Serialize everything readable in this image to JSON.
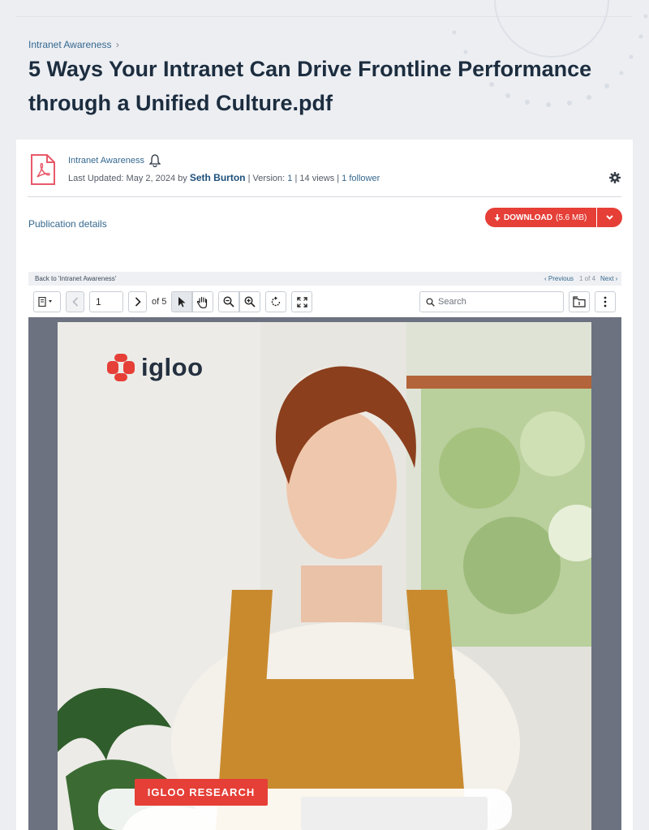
{
  "breadcrumb": {
    "label": "Intranet Awareness",
    "separator": "›"
  },
  "page_title": "5 Ways Your Intranet Can Drive Frontline Performance through a Unified Culture.pdf",
  "file_meta": {
    "space_name": "Intranet Awareness",
    "last_updated_prefix": "Last Updated: May 2, 2024 by",
    "author": "Seth Burton",
    "version_prefix": "| Version:",
    "version": "1",
    "views": "| 14 views |",
    "followers": "1 follower"
  },
  "publication_details": "Publication details",
  "download": {
    "label": "DOWNLOAD",
    "size": "(5.6 MB)"
  },
  "pager": {
    "back_label": "Back to 'Intranet Awareness'",
    "previous": "‹ Previous",
    "count": "1 of 4",
    "next": "Next ›"
  },
  "viewer_toolbar": {
    "page_value": "1",
    "of_total": "of 5",
    "search_placeholder": "Search"
  },
  "document": {
    "logo_text": "igloo",
    "badge": "IGLOO RESEARCH"
  },
  "colors": {
    "accent_red": "#e53f37",
    "link_blue": "#35688f",
    "title_navy": "#1c2d3f",
    "viewer_gray": "#6c7280"
  },
  "icons": [
    "pdf-file-icon",
    "bell-icon",
    "gear-icon",
    "download-arrow-icon",
    "chevron-down-icon",
    "sidebar-toggle-icon",
    "chevron-left-icon",
    "chevron-right-icon",
    "pointer-icon",
    "hand-icon",
    "zoom-out-icon",
    "zoom-in-icon",
    "rotate-icon",
    "fullscreen-icon",
    "search-icon",
    "open-file-icon",
    "more-vertical-icon",
    "igloo-logo-icon"
  ]
}
